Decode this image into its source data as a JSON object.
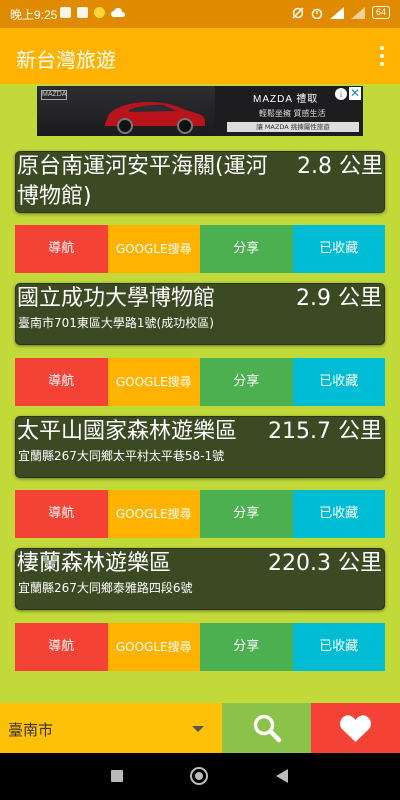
{
  "status_bar": {
    "time": "晚上9:25",
    "battery": "64"
  },
  "app_bar": {
    "title": "新台灣旅遊"
  },
  "ad": {
    "logo": "MAZDA",
    "brand": "MAZDA 禮取",
    "tagline": "輕鬆坐擁 質感生活",
    "bottom_text": "讓 MAZDA 挑揀屬性旅遊",
    "info_icon": "i",
    "close_icon": "✕"
  },
  "places": [
    {
      "name_line1": "原台南運河安平海關(運河",
      "name_line2": "博物館)",
      "distance": "2.8 公里",
      "address": ""
    },
    {
      "name_line1": "國立成功大學博物館",
      "name_line2": "",
      "distance": "2.9 公里",
      "address": "臺南市701東區大學路1號(成功校區)"
    },
    {
      "name_line1": "太平山國家森林遊樂區",
      "name_line2": "",
      "distance": "215.7 公里",
      "address": "宜蘭縣267大同鄉太平村太平巷58-1號"
    },
    {
      "name_line1": "棲蘭森林遊樂區",
      "name_line2": "",
      "distance": "220.3 公里",
      "address": "宜蘭縣267大同鄉泰雅路四段6號"
    }
  ],
  "actions": {
    "navigate": "導航",
    "google": "GOOGLE搜尋",
    "share": "分享",
    "favorited": "已收藏"
  },
  "bottom_bar": {
    "region": "臺南市"
  },
  "colors": {
    "status_bar": "#e08a00",
    "app_bar": "#ffb300",
    "content_bg": "#c1d939",
    "card_bg": "#3b4a23",
    "btn_nav": "#f44336",
    "btn_google": "#ffb300",
    "btn_share": "#4caf50",
    "btn_fav": "#00bcd4"
  },
  "icons": {
    "menu": "overflow-menu-icon",
    "search": "search-icon",
    "favorites": "heart-icon",
    "dropdown": "dropdown-arrow-icon"
  }
}
